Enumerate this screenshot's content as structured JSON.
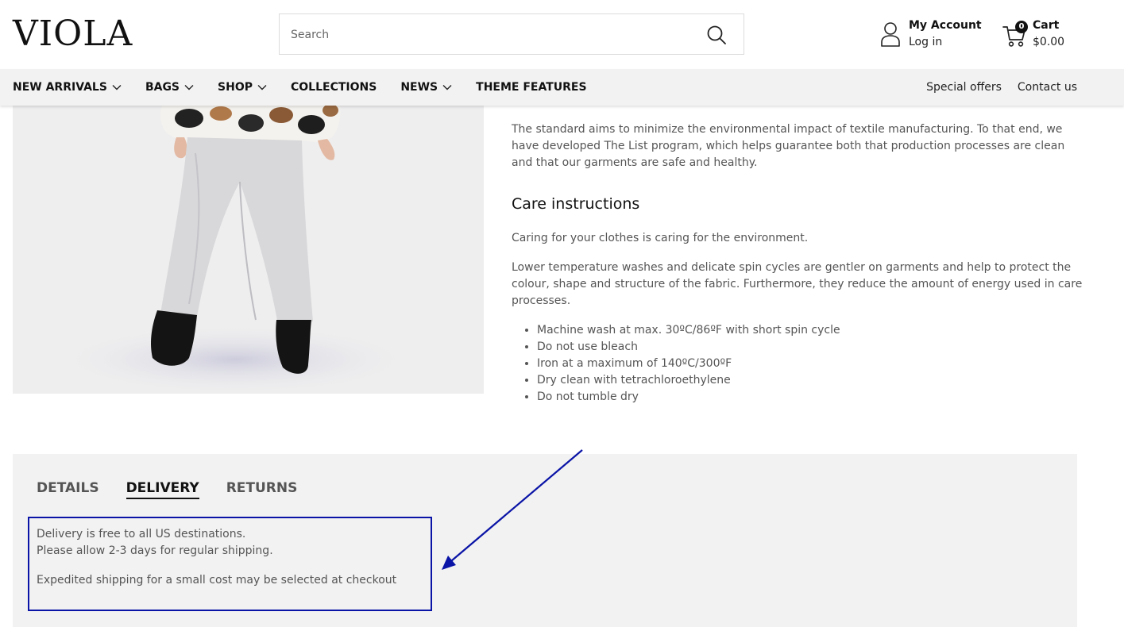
{
  "header": {
    "logo": "VIOLA",
    "search_placeholder": "Search",
    "account_title": "My Account",
    "account_login": "Log in",
    "cart_count": "0",
    "cart_title": "Cart",
    "cart_total": "$0.00"
  },
  "nav": {
    "items": [
      {
        "label": "NEW ARRIVALS",
        "dropdown": true
      },
      {
        "label": "BAGS",
        "dropdown": true
      },
      {
        "label": "SHOP",
        "dropdown": true
      },
      {
        "label": "COLLECTIONS",
        "dropdown": false
      },
      {
        "label": "NEWS",
        "dropdown": true
      },
      {
        "label": "THEME FEATURES",
        "dropdown": false
      }
    ],
    "right": [
      "Special offers",
      "Contact us"
    ]
  },
  "description": {
    "paragraph1": "The standard aims to minimize the environmental impact of textile manufacturing. To that end, we have developed The List program, which helps guarantee both that production processes are clean and that our garments are safe and healthy.",
    "care_heading": "Care instructions",
    "paragraph2": "Caring for your clothes is caring for the environment.",
    "paragraph3": "Lower temperature washes and delicate spin cycles are gentler on garments and help to protect the colour, shape and structure of the fabric. Furthermore, they reduce the amount of energy used in care processes.",
    "bullets": [
      "Machine wash at max. 30ºC/86ºF with short spin cycle",
      "Do not use bleach",
      "Iron at a maximum of 140ºC/300ºF",
      "Dry clean with tetrachloroethylene",
      "Do not tumble dry"
    ]
  },
  "tabs": {
    "items": [
      "DETAILS",
      "DELIVERY",
      "RETURNS"
    ],
    "active": "DELIVERY",
    "content": {
      "line1": "Delivery is free to all US destinations.",
      "line2": "Please allow 2-3 days for regular shipping.",
      "line3": "Expedited shipping for a small cost may be selected at checkout"
    }
  },
  "colors": {
    "annotation": "#0a14a6",
    "nav_bg": "#f2f2f2",
    "panel_bg": "#f2f2f2"
  }
}
